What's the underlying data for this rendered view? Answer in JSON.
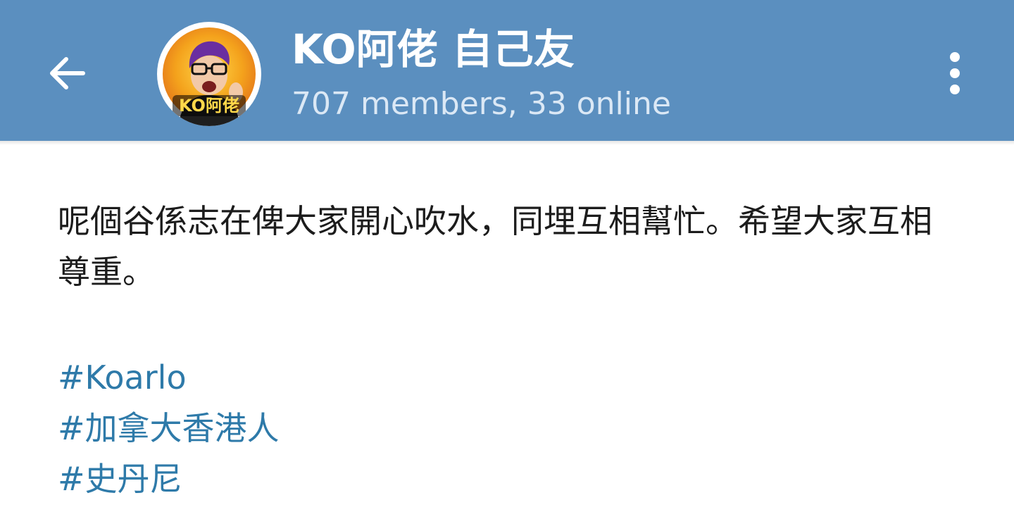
{
  "header": {
    "title": "KO阿佬 自己友",
    "subtitle": "707 members, 33 online",
    "avatar_badge_text": "KO阿佬",
    "back_icon": "arrow-left-icon",
    "menu_icon": "more-vertical-icon",
    "background_color": "#5b8fbf"
  },
  "info": {
    "description": "呢個谷係志在俾大家開心吹水，同埋互相幫忙。希望大家互相尊重。",
    "hashtags": [
      "#Koarlo",
      "#加拿大香港人",
      "#史丹尼"
    ],
    "link_color": "#2e7aa9"
  }
}
